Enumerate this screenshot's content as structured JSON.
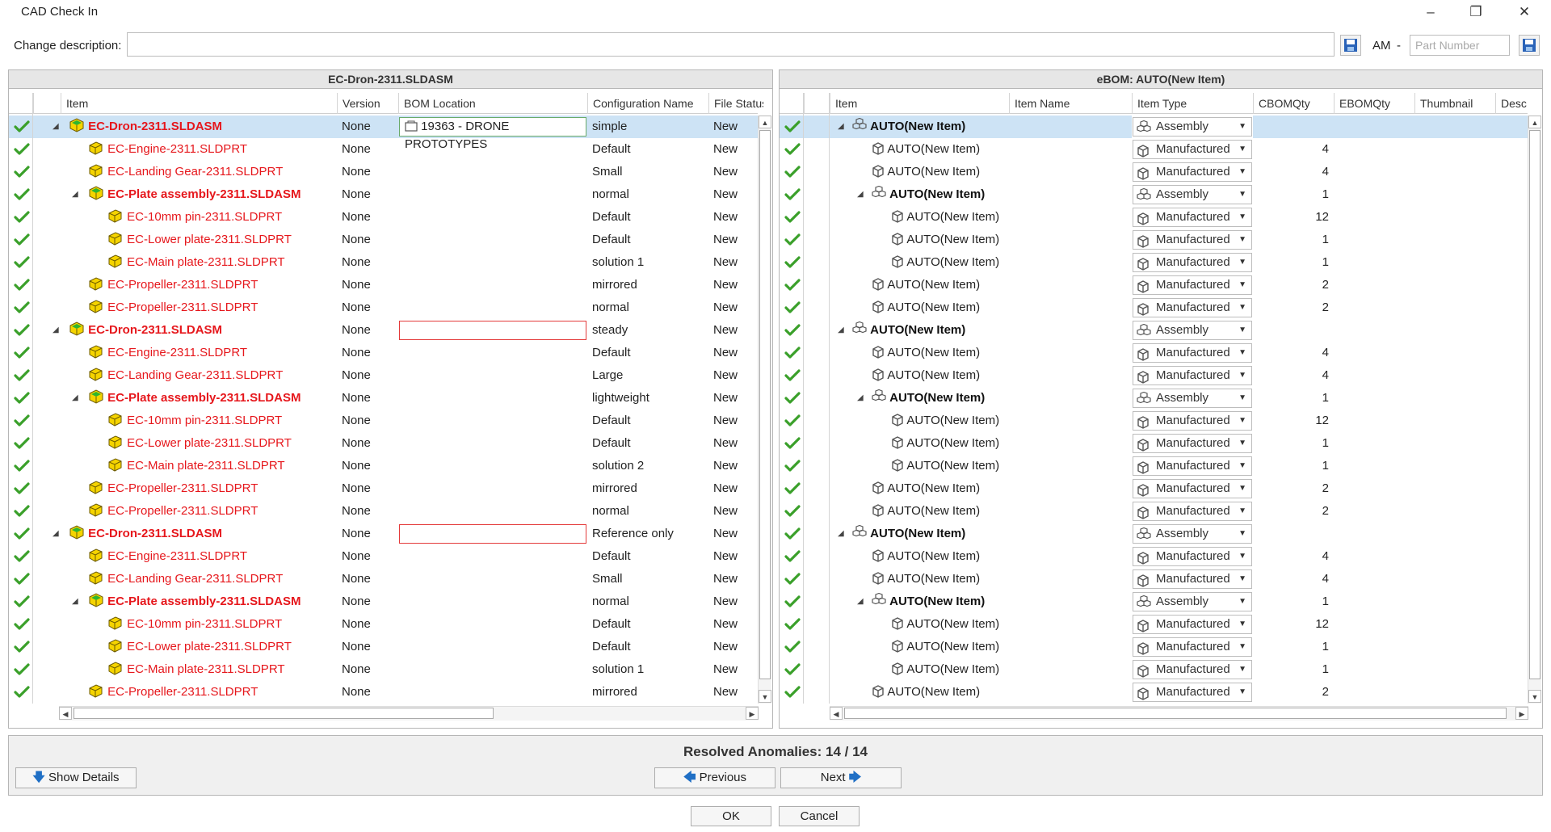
{
  "window": {
    "title": "CAD Check In"
  },
  "desc": {
    "label": "Change description:",
    "value": "",
    "am_label": "AM",
    "dash": "-",
    "part_placeholder": "Part Number"
  },
  "left": {
    "title": "EC-Dron-2311.SLDASM",
    "cols": [
      "Item",
      "Version",
      "BOM Location",
      "Configuration Name",
      "File Status"
    ],
    "rows": [
      {
        "level": 0,
        "type": "asm",
        "name": "EC-Dron-2311.SLDASM",
        "version": "None",
        "bom": "19363 - DRONE PROTOTYPES",
        "bomstate": "ok",
        "config": "simple",
        "status": "New",
        "sel": true
      },
      {
        "level": 1,
        "type": "part",
        "name": "EC-Engine-2311.SLDPRT",
        "version": "None",
        "bom": "",
        "bomstate": "",
        "config": "Default",
        "status": "New"
      },
      {
        "level": 1,
        "type": "part",
        "name": "EC-Landing Gear-2311.SLDPRT",
        "version": "None",
        "bom": "",
        "bomstate": "",
        "config": "Small",
        "status": "New"
      },
      {
        "level": 1,
        "type": "asm",
        "name": "EC-Plate assembly-2311.SLDASM",
        "version": "None",
        "bom": "",
        "bomstate": "",
        "config": "normal",
        "status": "New"
      },
      {
        "level": 2,
        "type": "part",
        "name": "EC-10mm pin-2311.SLDPRT",
        "version": "None",
        "bom": "",
        "bomstate": "",
        "config": "Default",
        "status": "New"
      },
      {
        "level": 2,
        "type": "part",
        "name": "EC-Lower plate-2311.SLDPRT",
        "version": "None",
        "bom": "",
        "bomstate": "",
        "config": "Default",
        "status": "New"
      },
      {
        "level": 2,
        "type": "part",
        "name": "EC-Main plate-2311.SLDPRT",
        "version": "None",
        "bom": "",
        "bomstate": "",
        "config": "solution 1",
        "status": "New"
      },
      {
        "level": 1,
        "type": "part",
        "name": "EC-Propeller-2311.SLDPRT",
        "version": "None",
        "bom": "",
        "bomstate": "",
        "config": "mirrored",
        "status": "New"
      },
      {
        "level": 1,
        "type": "part",
        "name": "EC-Propeller-2311.SLDPRT",
        "version": "None",
        "bom": "",
        "bomstate": "",
        "config": "normal",
        "status": "New"
      },
      {
        "level": 0,
        "type": "asm",
        "name": "EC-Dron-2311.SLDASM",
        "version": "None",
        "bom": "",
        "bomstate": "err",
        "config": "steady",
        "status": "New"
      },
      {
        "level": 1,
        "type": "part",
        "name": "EC-Engine-2311.SLDPRT",
        "version": "None",
        "bom": "",
        "bomstate": "",
        "config": "Default",
        "status": "New"
      },
      {
        "level": 1,
        "type": "part",
        "name": "EC-Landing Gear-2311.SLDPRT",
        "version": "None",
        "bom": "",
        "bomstate": "",
        "config": "Large",
        "status": "New"
      },
      {
        "level": 1,
        "type": "asm",
        "name": "EC-Plate assembly-2311.SLDASM",
        "version": "None",
        "bom": "",
        "bomstate": "",
        "config": "lightweight",
        "status": "New"
      },
      {
        "level": 2,
        "type": "part",
        "name": "EC-10mm pin-2311.SLDPRT",
        "version": "None",
        "bom": "",
        "bomstate": "",
        "config": "Default",
        "status": "New"
      },
      {
        "level": 2,
        "type": "part",
        "name": "EC-Lower plate-2311.SLDPRT",
        "version": "None",
        "bom": "",
        "bomstate": "",
        "config": "Default",
        "status": "New"
      },
      {
        "level": 2,
        "type": "part",
        "name": "EC-Main plate-2311.SLDPRT",
        "version": "None",
        "bom": "",
        "bomstate": "",
        "config": "solution 2",
        "status": "New"
      },
      {
        "level": 1,
        "type": "part",
        "name": "EC-Propeller-2311.SLDPRT",
        "version": "None",
        "bom": "",
        "bomstate": "",
        "config": "mirrored",
        "status": "New"
      },
      {
        "level": 1,
        "type": "part",
        "name": "EC-Propeller-2311.SLDPRT",
        "version": "None",
        "bom": "",
        "bomstate": "",
        "config": "normal",
        "status": "New"
      },
      {
        "level": 0,
        "type": "asm",
        "name": "EC-Dron-2311.SLDASM",
        "version": "None",
        "bom": "",
        "bomstate": "err",
        "config": "Reference only",
        "status": "New"
      },
      {
        "level": 1,
        "type": "part",
        "name": "EC-Engine-2311.SLDPRT",
        "version": "None",
        "bom": "",
        "bomstate": "",
        "config": "Default",
        "status": "New"
      },
      {
        "level": 1,
        "type": "part",
        "name": "EC-Landing Gear-2311.SLDPRT",
        "version": "None",
        "bom": "",
        "bomstate": "",
        "config": "Small",
        "status": "New"
      },
      {
        "level": 1,
        "type": "asm",
        "name": "EC-Plate assembly-2311.SLDASM",
        "version": "None",
        "bom": "",
        "bomstate": "",
        "config": "normal",
        "status": "New"
      },
      {
        "level": 2,
        "type": "part",
        "name": "EC-10mm pin-2311.SLDPRT",
        "version": "None",
        "bom": "",
        "bomstate": "",
        "config": "Default",
        "status": "New"
      },
      {
        "level": 2,
        "type": "part",
        "name": "EC-Lower plate-2311.SLDPRT",
        "version": "None",
        "bom": "",
        "bomstate": "",
        "config": "Default",
        "status": "New"
      },
      {
        "level": 2,
        "type": "part",
        "name": "EC-Main plate-2311.SLDPRT",
        "version": "None",
        "bom": "",
        "bomstate": "",
        "config": "solution 1",
        "status": "New"
      },
      {
        "level": 1,
        "type": "part",
        "name": "EC-Propeller-2311.SLDPRT",
        "version": "None",
        "bom": "",
        "bomstate": "",
        "config": "mirrored",
        "status": "New"
      }
    ]
  },
  "right": {
    "title": "eBOM: AUTO(New Item)",
    "cols": [
      "Item",
      "Item Name",
      "Item Type",
      "CBOMQty",
      "EBOMQty",
      "Thumbnail",
      "Desc"
    ],
    "rows": [
      {
        "level": 0,
        "type": "asm",
        "name": "AUTO(New Item)",
        "itype": "Assembly",
        "cbom": "",
        "sel": true
      },
      {
        "level": 1,
        "type": "part",
        "name": "AUTO(New Item)",
        "itype": "Manufactured",
        "cbom": "4"
      },
      {
        "level": 1,
        "type": "part",
        "name": "AUTO(New Item)",
        "itype": "Manufactured",
        "cbom": "4"
      },
      {
        "level": 1,
        "type": "asm",
        "name": "AUTO(New Item)",
        "itype": "Assembly",
        "cbom": "1"
      },
      {
        "level": 2,
        "type": "part",
        "name": "AUTO(New Item)",
        "itype": "Manufactured",
        "cbom": "12"
      },
      {
        "level": 2,
        "type": "part",
        "name": "AUTO(New Item)",
        "itype": "Manufactured",
        "cbom": "1"
      },
      {
        "level": 2,
        "type": "part",
        "name": "AUTO(New Item)",
        "itype": "Manufactured",
        "cbom": "1"
      },
      {
        "level": 1,
        "type": "part",
        "name": "AUTO(New Item)",
        "itype": "Manufactured",
        "cbom": "2"
      },
      {
        "level": 1,
        "type": "part",
        "name": "AUTO(New Item)",
        "itype": "Manufactured",
        "cbom": "2"
      },
      {
        "level": 0,
        "type": "asm",
        "name": "AUTO(New Item)",
        "itype": "Assembly",
        "cbom": ""
      },
      {
        "level": 1,
        "type": "part",
        "name": "AUTO(New Item)",
        "itype": "Manufactured",
        "cbom": "4"
      },
      {
        "level": 1,
        "type": "part",
        "name": "AUTO(New Item)",
        "itype": "Manufactured",
        "cbom": "4"
      },
      {
        "level": 1,
        "type": "asm",
        "name": "AUTO(New Item)",
        "itype": "Assembly",
        "cbom": "1"
      },
      {
        "level": 2,
        "type": "part",
        "name": "AUTO(New Item)",
        "itype": "Manufactured",
        "cbom": "12"
      },
      {
        "level": 2,
        "type": "part",
        "name": "AUTO(New Item)",
        "itype": "Manufactured",
        "cbom": "1"
      },
      {
        "level": 2,
        "type": "part",
        "name": "AUTO(New Item)",
        "itype": "Manufactured",
        "cbom": "1"
      },
      {
        "level": 1,
        "type": "part",
        "name": "AUTO(New Item)",
        "itype": "Manufactured",
        "cbom": "2"
      },
      {
        "level": 1,
        "type": "part",
        "name": "AUTO(New Item)",
        "itype": "Manufactured",
        "cbom": "2"
      },
      {
        "level": 0,
        "type": "asm",
        "name": "AUTO(New Item)",
        "itype": "Assembly",
        "cbom": ""
      },
      {
        "level": 1,
        "type": "part",
        "name": "AUTO(New Item)",
        "itype": "Manufactured",
        "cbom": "4"
      },
      {
        "level": 1,
        "type": "part",
        "name": "AUTO(New Item)",
        "itype": "Manufactured",
        "cbom": "4"
      },
      {
        "level": 1,
        "type": "asm",
        "name": "AUTO(New Item)",
        "itype": "Assembly",
        "cbom": "1"
      },
      {
        "level": 2,
        "type": "part",
        "name": "AUTO(New Item)",
        "itype": "Manufactured",
        "cbom": "12"
      },
      {
        "level": 2,
        "type": "part",
        "name": "AUTO(New Item)",
        "itype": "Manufactured",
        "cbom": "1"
      },
      {
        "level": 2,
        "type": "part",
        "name": "AUTO(New Item)",
        "itype": "Manufactured",
        "cbom": "1"
      },
      {
        "level": 1,
        "type": "part",
        "name": "AUTO(New Item)",
        "itype": "Manufactured",
        "cbom": "2"
      }
    ]
  },
  "bottom": {
    "resolved": "Resolved Anomalies: 14 / 14",
    "show_details": "Show Details",
    "previous": "Previous",
    "next": "Next"
  },
  "footer": {
    "ok": "OK",
    "cancel": "Cancel"
  },
  "colors": {
    "accent": "#1f6fc5",
    "error": "#e6171c",
    "check": "#3aa02a",
    "selected": "#cde3f5"
  }
}
